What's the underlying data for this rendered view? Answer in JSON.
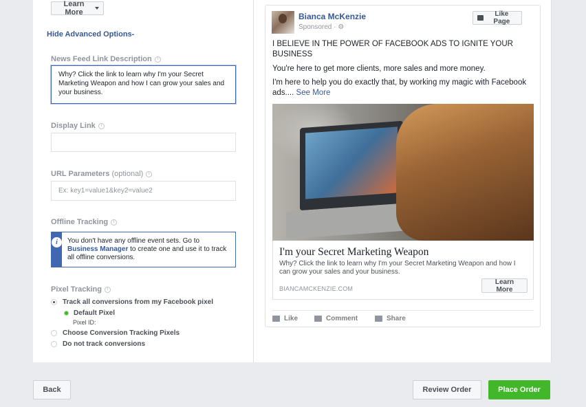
{
  "left": {
    "learn_more": "Learn More",
    "hide_advanced": "Hide Advanced Options",
    "news_feed_label": "News Feed Link Description",
    "news_feed_value": "Why? Click the link to learn why I'm your Secret Marketing Weapon and how I can grow your sales and your business.",
    "display_link_label": "Display Link",
    "display_link_value": "",
    "url_params_label": "URL Parameters",
    "url_params_optional": "(optional)",
    "url_params_placeholder": "Ex: key1=value1&key2=value2",
    "offline_label": "Offline Tracking",
    "offline_text_before": "You don't have any offline event sets. Go to",
    "offline_link": "Business Manager",
    "offline_text_after": "to create one and use it to track all offline conversions.",
    "pixel_label": "Pixel Tracking",
    "radio_track_all": "Track all conversions from my Facebook pixel",
    "default_pixel": "Default Pixel",
    "pixel_id": "Pixel ID:",
    "radio_choose": "Choose Conversion Tracking Pixels",
    "radio_none": "Do not track conversions"
  },
  "preview": {
    "page_name": "Bianca McKenzie",
    "sponsored": "Sponsored",
    "like_page": "Like Page",
    "post_line1": "I BELIEVE IN THE POWER OF FACEBOOK ADS TO IGNITE YOUR BUSINESS",
    "post_line2": "You're here to get more clients, more sales and more money.",
    "post_line3": "I'm here to help you do exactly that, by working my magic with Facebook ads....",
    "see_more": "See More",
    "headline": "I'm your Secret Marketing Weapon",
    "description": "Why? Click the link to learn why I'm your Secret Marketing Weapon and how I can grow your sales and your business.",
    "domain": "BIANCAMCKENZIE.COM",
    "cta": "Learn More",
    "like": "Like",
    "comment": "Comment",
    "share": "Share"
  },
  "footer": {
    "back": "Back",
    "review": "Review Order",
    "place": "Place Order"
  },
  "colors": {
    "accent": "#4267b2",
    "link": "#365899",
    "success": "#42b72a"
  }
}
